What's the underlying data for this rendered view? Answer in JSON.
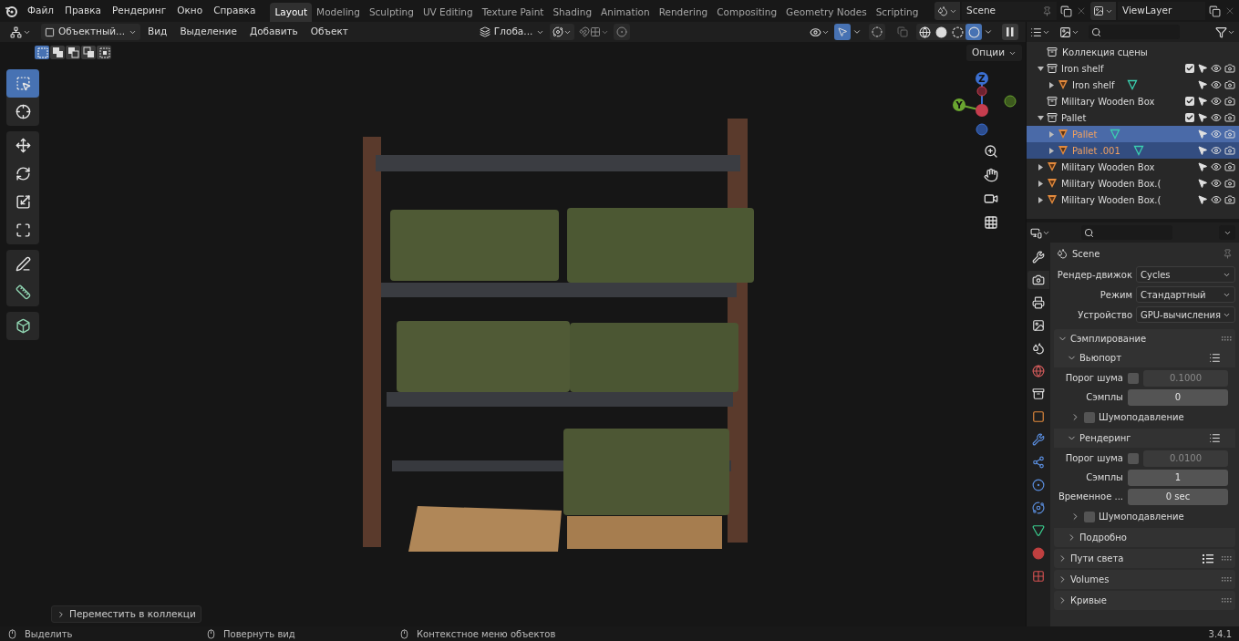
{
  "top_menu": [
    "Файл",
    "Правка",
    "Рендеринг",
    "Окно",
    "Справка"
  ],
  "workspaces": [
    {
      "label": "Layout",
      "selected": true
    },
    {
      "label": "Modeling",
      "selected": false
    },
    {
      "label": "Sculpting",
      "selected": false
    },
    {
      "label": "UV Editing",
      "selected": false
    },
    {
      "label": "Texture Paint",
      "selected": false
    },
    {
      "label": "Shading",
      "selected": false
    },
    {
      "label": "Animation",
      "selected": false
    },
    {
      "label": "Rendering",
      "selected": false
    },
    {
      "label": "Compositing",
      "selected": false
    },
    {
      "label": "Geometry Nodes",
      "selected": false
    },
    {
      "label": "Scripting",
      "selected": false
    }
  ],
  "scene": {
    "name": "Scene"
  },
  "view_layer": {
    "name": "ViewLayer"
  },
  "viewport_header": {
    "mode": "Объектный...",
    "menus": [
      "Вид",
      "Выделение",
      "Добавить",
      "Объект"
    ],
    "orientation": "Глоба...",
    "gizmos_on": true,
    "shading": [
      {
        "kind": "wireframe",
        "selected": false
      },
      {
        "kind": "solid",
        "selected": false
      },
      {
        "kind": "material",
        "selected": false
      },
      {
        "kind": "rendered",
        "selected": true
      }
    ]
  },
  "select_modes": [
    {
      "kind": "set",
      "selected": true
    },
    {
      "kind": "extend",
      "selected": false
    },
    {
      "kind": "subtract",
      "selected": false
    },
    {
      "kind": "invert",
      "selected": false
    },
    {
      "kind": "intersect",
      "selected": false
    }
  ],
  "options_button": "Опции",
  "tool_groups": [
    {
      "tools": [
        {
          "kind": "select",
          "selected": true
        },
        {
          "kind": "cursor",
          "selected": false
        }
      ]
    },
    {
      "tools": [
        {
          "kind": "move",
          "selected": false
        },
        {
          "kind": "rotate",
          "selected": false
        },
        {
          "kind": "scale",
          "selected": false
        },
        {
          "kind": "transform",
          "selected": false
        }
      ]
    },
    {
      "tools": [
        {
          "kind": "annotate",
          "selected": false
        },
        {
          "kind": "measure",
          "selected": false
        }
      ]
    },
    {
      "tools": [
        {
          "kind": "add_cube",
          "selected": false
        }
      ]
    }
  ],
  "gizmo": {
    "z_label": "Z",
    "y_label": "Y"
  },
  "last_operator": "Переместить в коллекци",
  "outliner": {
    "root": "Коллекция сцены",
    "items": [
      {
        "name": "Iron shelf",
        "kind": "collection",
        "expanded": true,
        "checked": true,
        "selected": false,
        "active": false,
        "children": [
          {
            "name": "Iron shelf",
            "kind": "mesh",
            "expanded": false,
            "has_data": true,
            "selected": false,
            "active": false
          }
        ]
      },
      {
        "name": "Military Wooden Box",
        "kind": "collection",
        "checked": true,
        "selected": false,
        "active": false
      },
      {
        "name": "Pallet",
        "kind": "collection",
        "expanded": true,
        "checked": true,
        "selected": false,
        "active": false,
        "children": [
          {
            "name": "Pallet",
            "kind": "mesh",
            "expanded": false,
            "has_data": true,
            "selected": true,
            "active": true
          },
          {
            "name": "Pallet .001",
            "kind": "mesh",
            "expanded": false,
            "has_data": true,
            "selected": true,
            "active": false
          }
        ]
      },
      {
        "name": "Military Wooden Box",
        "kind": "mesh",
        "expanded": false,
        "has_data": false,
        "selected": false,
        "active": false
      },
      {
        "name": "Military Wooden Box.(",
        "kind": "mesh",
        "expanded": false,
        "has_data": false,
        "selected": false,
        "active": false
      },
      {
        "name": "Military Wooden Box.(",
        "kind": "mesh",
        "expanded": false,
        "has_data": false,
        "selected": false,
        "active": false
      }
    ]
  },
  "properties": {
    "tabs": [
      {
        "kind": "tool",
        "selected": false
      },
      {
        "kind": "render",
        "selected": true
      },
      {
        "kind": "output",
        "selected": false
      },
      {
        "kind": "view_layer",
        "selected": false
      },
      {
        "kind": "scene",
        "selected": false
      },
      {
        "kind": "world",
        "selected": false
      },
      {
        "kind": "collection",
        "selected": false
      },
      {
        "kind": "object",
        "selected": false
      },
      {
        "kind": "modifiers",
        "selected": false
      },
      {
        "kind": "particles",
        "selected": false
      },
      {
        "kind": "physics",
        "selected": false
      },
      {
        "kind": "constraints",
        "selected": false
      },
      {
        "kind": "data",
        "selected": false
      },
      {
        "kind": "material",
        "selected": false
      },
      {
        "kind": "texture",
        "selected": false
      }
    ],
    "context": "Scene",
    "fields": [
      {
        "label": "Рендер-движок",
        "value": "Cycles"
      },
      {
        "label": "Режим",
        "value": "Стандартный"
      },
      {
        "label": "Устройство",
        "value": "GPU-вычисления"
      }
    ],
    "sampling": {
      "title": "Сэмплирование",
      "expanded": true,
      "subpanels": [
        {
          "title": "Вьюпорт",
          "expanded": true,
          "rows": [
            {
              "kind": "check_number",
              "label": "Порог шума",
              "checked": false,
              "value": "0.1000",
              "disabled": true
            },
            {
              "kind": "number",
              "label": "Сэмплы",
              "value": "0",
              "disabled": false
            }
          ],
          "denoise": {
            "title": "Шумоподавление",
            "checked": false,
            "expanded": false
          }
        },
        {
          "title": "Рендеринг",
          "expanded": true,
          "rows": [
            {
              "kind": "check_number",
              "label": "Порог шума",
              "checked": false,
              "value": "0.0100",
              "disabled": true
            },
            {
              "kind": "number",
              "label": "Сэмплы",
              "value": "1",
              "disabled": false
            },
            {
              "kind": "number",
              "label": "Временное ...",
              "value": "0 sec",
              "disabled": false
            }
          ],
          "denoise": {
            "title": "Шумоподавление",
            "checked": false,
            "expanded": false
          }
        }
      ],
      "details": {
        "title": "Подробно",
        "expanded": false
      }
    },
    "panels": [
      {
        "title": "Пути света",
        "expanded": false,
        "presets": true
      },
      {
        "title": "Volumes",
        "expanded": false,
        "presets": false
      },
      {
        "title": "Кривые",
        "expanded": false,
        "presets": false
      }
    ]
  },
  "status_bar": {
    "hints": [
      "Выделить",
      "Повернуть вид",
      "Контекстное меню объектов"
    ],
    "version": "3.4.1"
  }
}
